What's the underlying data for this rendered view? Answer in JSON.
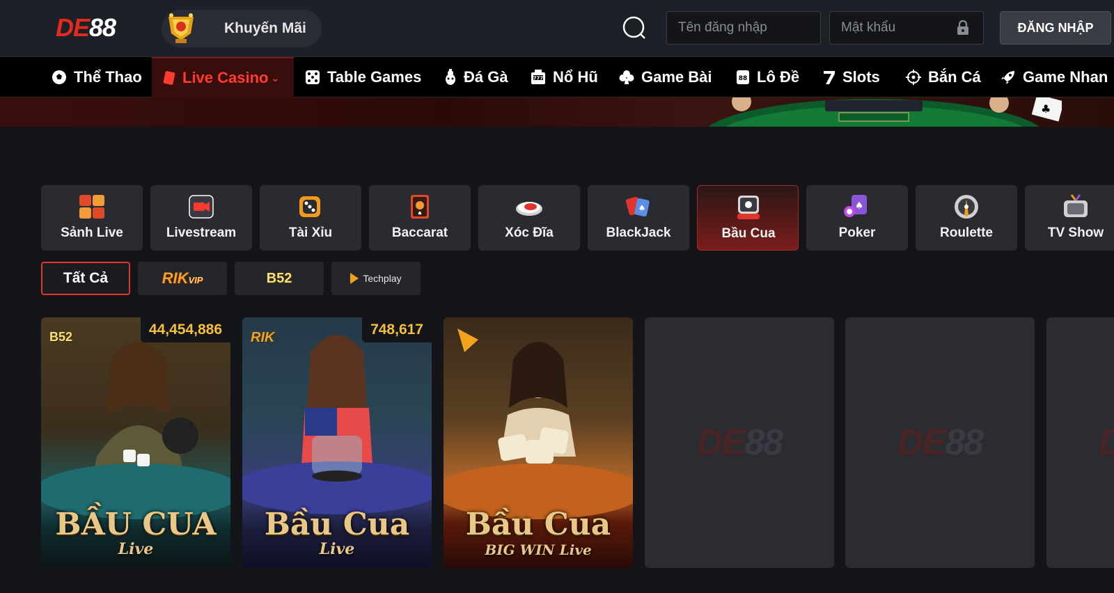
{
  "header": {
    "logo_de": "DE",
    "logo_num": "88",
    "promo_label": "Khuyến Mãi",
    "username_placeholder": "Tên đăng nhập",
    "password_placeholder": "Mật khẩu",
    "login_label": "ĐĂNG NHẬP"
  },
  "nav": {
    "items": [
      {
        "label": "Thể Thao",
        "icon": "soccer-ball-icon"
      },
      {
        "label": "Live Casino",
        "icon": "playing-card-icon",
        "active": true
      },
      {
        "label": "Table Games",
        "icon": "dice-icon"
      },
      {
        "label": "Đá Gà",
        "icon": "rooster-icon"
      },
      {
        "label": "Nổ Hũ",
        "icon": "slot-machine-icon"
      },
      {
        "label": "Game Bài",
        "icon": "club-icon"
      },
      {
        "label": "Lô Đề",
        "icon": "lottery-ball-icon"
      },
      {
        "label": "Slots",
        "icon": "seven-icon"
      },
      {
        "label": "Bắn Cá",
        "icon": "crosshair-icon"
      },
      {
        "label": "Game Nhan",
        "icon": "rocket-icon"
      }
    ]
  },
  "categories": [
    {
      "label": "Sảnh Live",
      "icon": "grid-lobby-icon"
    },
    {
      "label": "Livestream",
      "icon": "video-camera-icon"
    },
    {
      "label": "Tài Xỉu",
      "icon": "dice-icon"
    },
    {
      "label": "Baccarat",
      "icon": "card-icon"
    },
    {
      "label": "Xóc Đĩa",
      "icon": "plate-icon"
    },
    {
      "label": "BlackJack",
      "icon": "cards-icon"
    },
    {
      "label": "Bầu Cua",
      "icon": "crab-icon",
      "active": true
    },
    {
      "label": "Poker",
      "icon": "poker-chips-icon"
    },
    {
      "label": "Roulette",
      "icon": "roulette-icon"
    },
    {
      "label": "TV Show",
      "icon": "tv-icon"
    }
  ],
  "providers": {
    "all_label": "Tất Cả",
    "rik": "RIK",
    "rik_vip": "VIP",
    "b52": "B52",
    "techplay": "Techplay"
  },
  "games": [
    {
      "count": "44,454,886",
      "title": "BẦU CUA",
      "sub": "Live",
      "badge": "B52"
    },
    {
      "count": "748,617",
      "title": "Bầu Cua",
      "sub": "Live",
      "badge": "RIK"
    },
    {
      "title": "Bầu Cua",
      "sub": "BIG WIN Live"
    }
  ],
  "placeholder_logo": {
    "de": "DE",
    "num": "88"
  },
  "colors": {
    "accent": "#e0342c",
    "count": "#f4bf3a",
    "background": "#141519"
  }
}
